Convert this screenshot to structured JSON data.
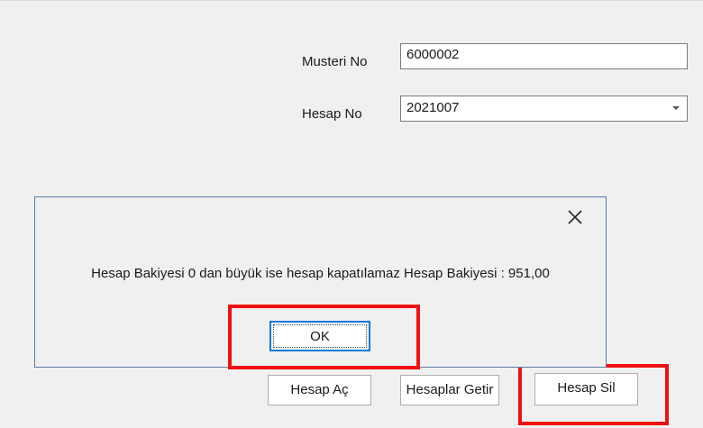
{
  "form": {
    "customer_no_label": "Musteri No",
    "customer_no_value": "6000002",
    "account_no_label": "Hesap No",
    "account_no_value": "2021007",
    "buttons": {
      "open_account": "Hesap Aç",
      "get_accounts": "Hesaplar Getir",
      "delete_account": "Hesap Sil"
    }
  },
  "dialog": {
    "message": "Hesap Bakiyesi 0 dan büyük ise hesap kapatılamaz Hesap Bakiyesi : 951,00",
    "ok_label": "OK",
    "close_icon": "close-icon"
  },
  "colors": {
    "highlight": "#ee1111",
    "focus_border": "#0078d7"
  }
}
